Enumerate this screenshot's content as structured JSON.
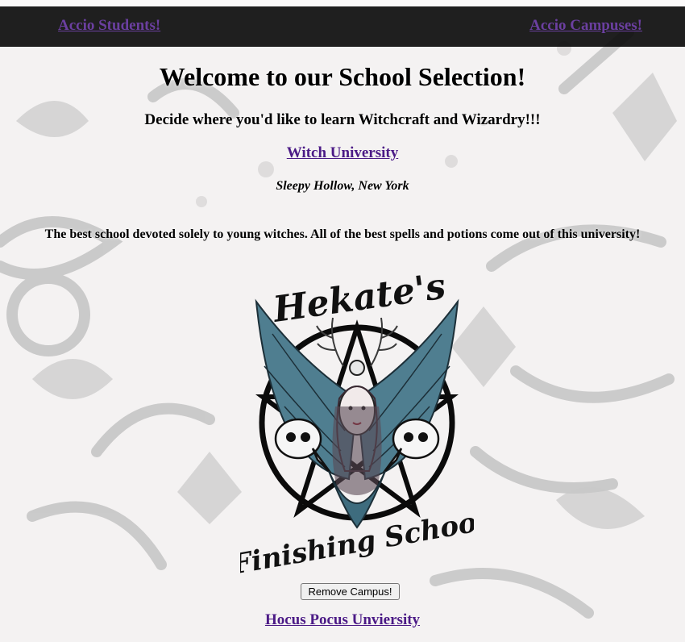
{
  "nav": {
    "students_link": "Accio Students!",
    "campuses_link": "Accio Campuses!"
  },
  "page": {
    "title": "Welcome to our School Selection!",
    "subtitle": "Decide where you'd like to learn Witchcraft and Wizardry!!!"
  },
  "campuses": [
    {
      "name": "Witch University",
      "location": "Sleepy Hollow, New York",
      "description": "The best school devoted solely to young witches. All of the best spells and potions come out of this university!",
      "logo_top_text": "Hekate's",
      "logo_bottom_text": "Finishing School",
      "remove_button": "Remove Campus!"
    },
    {
      "name": "Hocus Pocus Unviersity"
    }
  ],
  "colors": {
    "navbar_bg": "#080808",
    "link": "#6b3fa0",
    "campus_link": "#4b1a86",
    "page_bg": "#f4f2f2"
  },
  "icons": {
    "background": "mystic-illustration-background",
    "logo": "hekate-logo-icon"
  }
}
